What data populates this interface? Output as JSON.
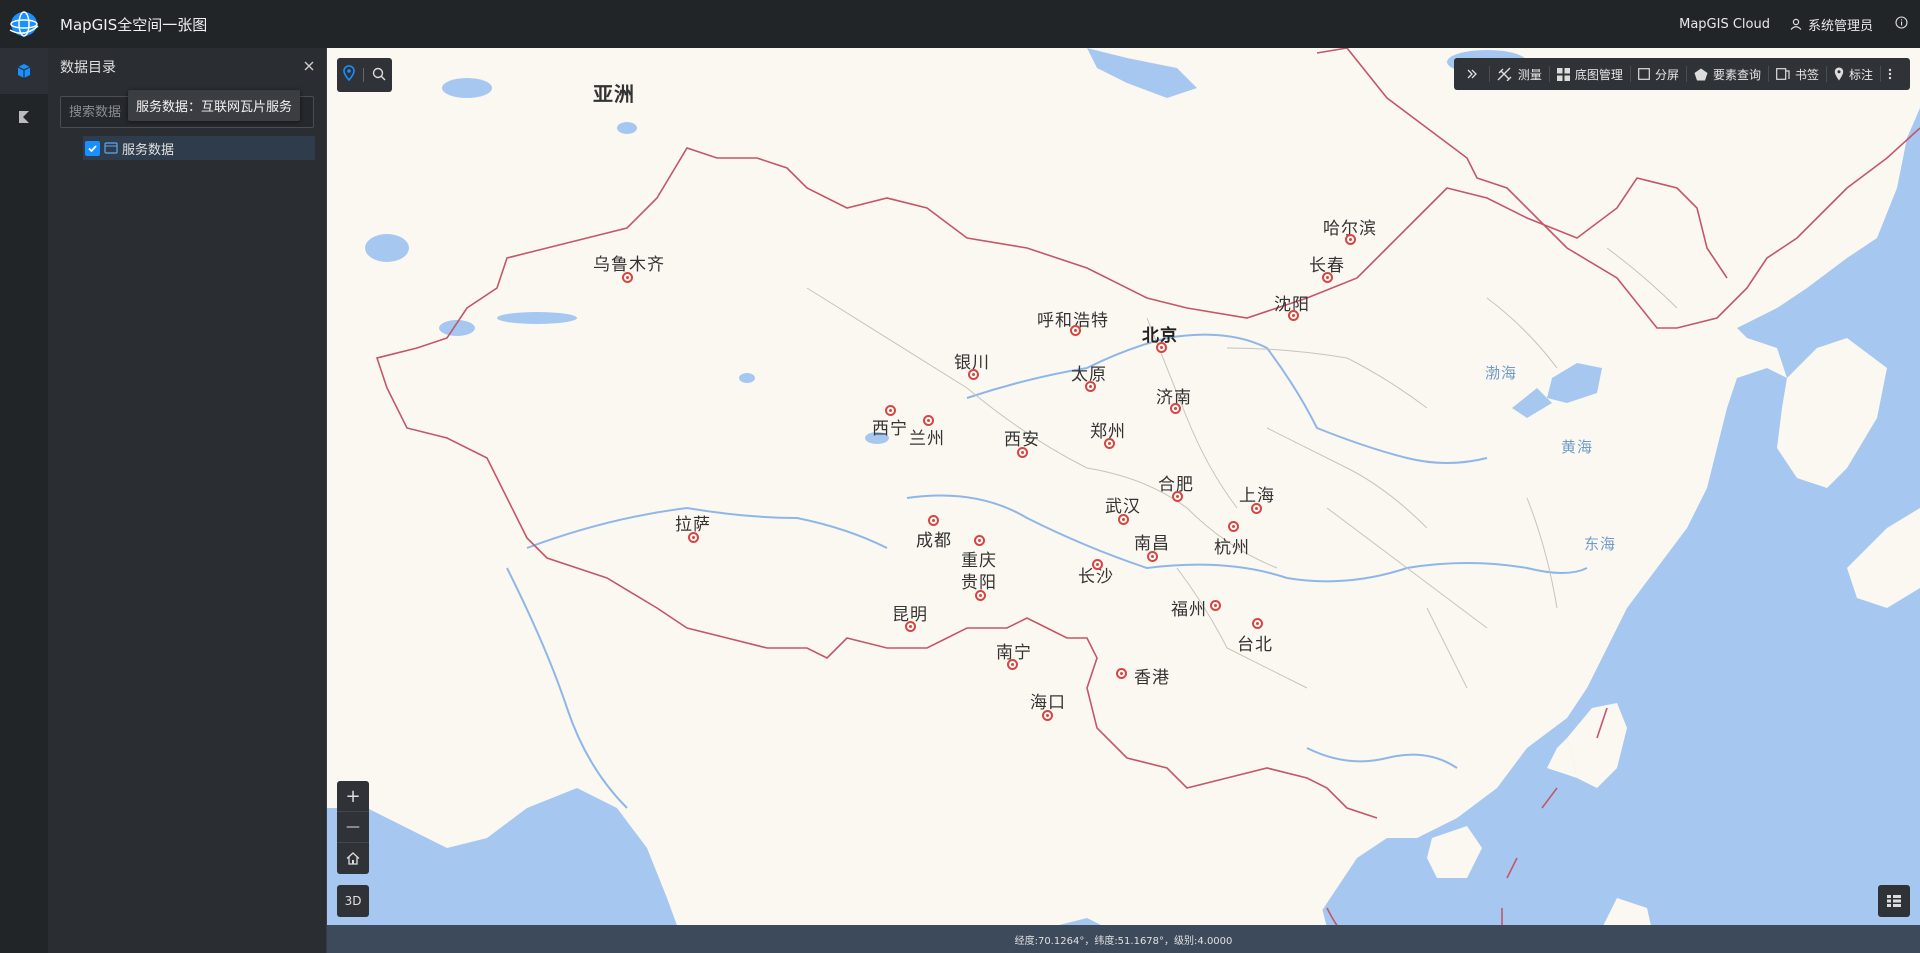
{
  "app": {
    "title": "MapGIS全空间一张图",
    "logo_icon": "globe-icon"
  },
  "header": {
    "cloud_label": "MapGIS Cloud",
    "user_name": "系统管理员",
    "info_icon": "info-icon"
  },
  "leftnav": {
    "items": [
      {
        "icon": "cube-icon",
        "active": true
      },
      {
        "icon": "layers-icon",
        "active": false
      }
    ]
  },
  "panel": {
    "title": "数据目录",
    "search_placeholder": "搜索数据",
    "tooltip": "服务数据：互联网瓦片服务",
    "tree": [
      {
        "label": "服务数据",
        "checked": true
      }
    ]
  },
  "map_tools_left": {
    "items": [
      "location-icon",
      "search-icon"
    ]
  },
  "map_tools_right": {
    "items": [
      {
        "icon": "expand-icon",
        "label": ""
      },
      {
        "icon": "measure-icon",
        "label": "测量"
      },
      {
        "icon": "basemap-icon",
        "label": "底图管理"
      },
      {
        "icon": "split-icon",
        "label": "分屏"
      },
      {
        "icon": "feature-query-icon",
        "label": "要素查询"
      },
      {
        "icon": "bookmark-icon",
        "label": "书签"
      },
      {
        "icon": "marker-icon",
        "label": "标注"
      },
      {
        "icon": "more-icon",
        "label": ""
      }
    ]
  },
  "zoom": {
    "in": "+",
    "out": "—",
    "home_icon": "home-icon"
  },
  "mode_button": "3D",
  "legend_icon": "legend-icon",
  "status": {
    "text": "经度:70.1264°，纬度:51.1678°，级别:4.0000"
  },
  "map": {
    "continent": "亚洲",
    "seas": [
      "渤海",
      "黄海",
      "东海"
    ],
    "cities": [
      "乌鲁木齐",
      "哈尔滨",
      "长春",
      "沈阳",
      "呼和浩特",
      "北京",
      "银川",
      "太原",
      "济南",
      "西宁",
      "兰州",
      "西安",
      "郑州",
      "拉萨",
      "合肥",
      "上海",
      "武汉",
      "成都",
      "南昌",
      "杭州",
      "重庆",
      "贵阳",
      "长沙",
      "福州",
      "昆明",
      "台北",
      "南宁",
      "香港",
      "海口"
    ]
  }
}
